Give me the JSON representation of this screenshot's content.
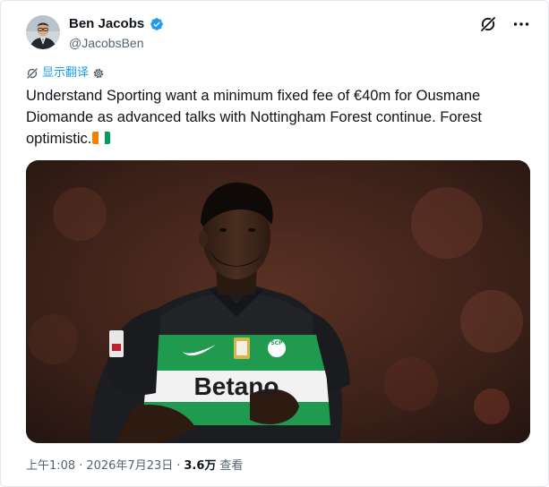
{
  "author": {
    "name": "Ben Jacobs",
    "handle": "@JacobsBen",
    "verified": true
  },
  "translate": {
    "label": "显示翻译"
  },
  "tweet": {
    "text": "Understand Sporting want a minimum fixed fee of €40m for Ousmane Diomande as advanced talks with Nottingham Forest continue. Forest optimistic.",
    "flag": "ivory-coast-flag"
  },
  "media": {
    "jersey_text": "Betano",
    "badge_text": "SCP"
  },
  "footer": {
    "time": "上午1:08",
    "separator1": "·",
    "date": "2026年7月23日",
    "separator2": "·",
    "views_count": "3.6万",
    "views_label": "查看"
  },
  "colors": {
    "accent": "#1d9bf0",
    "verified": "#1d9bf0",
    "text": "#0f1419",
    "muted": "#536471",
    "jersey_green": "#1f9a4f",
    "flag_orange": "#f77f00",
    "flag_white": "#ffffff",
    "flag_green": "#009e60"
  },
  "icons": [
    "avatar",
    "verified-icon",
    "grok-icon",
    "more-icon",
    "translate-icon",
    "settings-gear-icon"
  ]
}
